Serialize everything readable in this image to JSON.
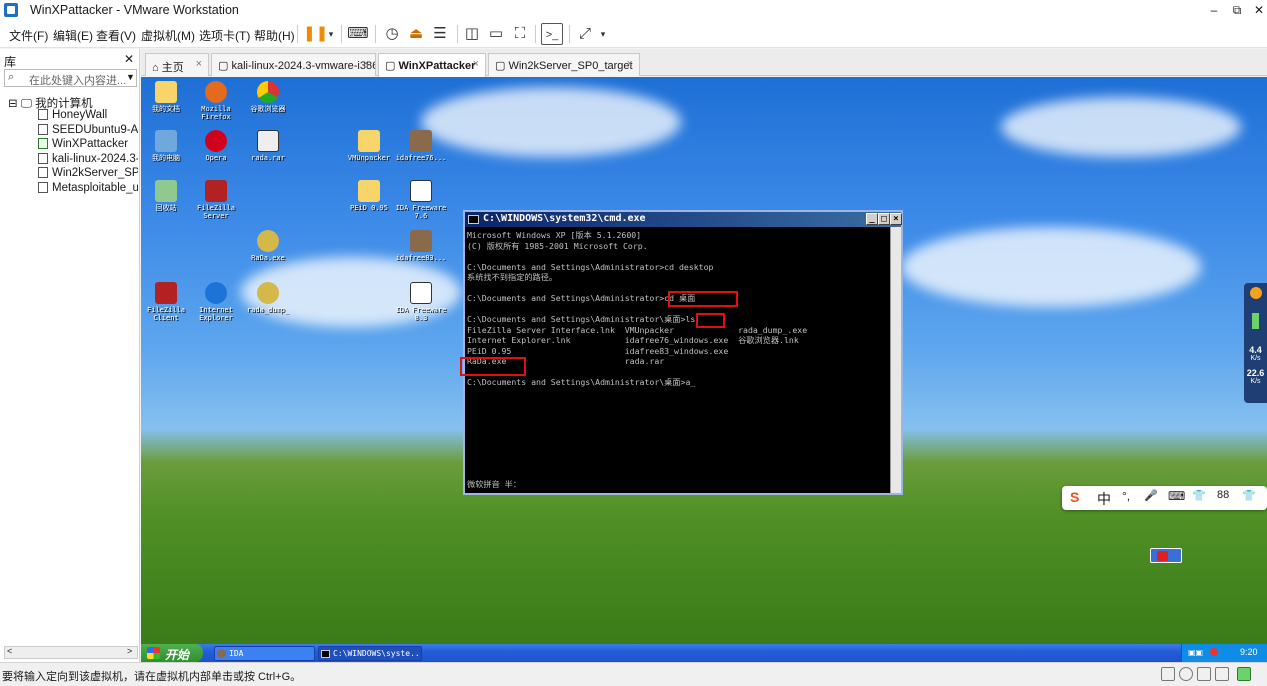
{
  "window": {
    "title": "WinXPattacker - VMware Workstation",
    "min": "–",
    "restore": "⧉",
    "close": "✕"
  },
  "menu": [
    "文件(F)",
    "编辑(E)",
    "查看(V)",
    "虚拟机(M)",
    "选项卡(T)",
    "帮助(H)"
  ],
  "toolbar_icons": [
    "pause-icon",
    "dropdown-icon",
    "send-ctrl-alt-del-icon",
    "snapshot-icon",
    "revert-snapshot-icon",
    "snapshot-manager-icon",
    "library-view-icon",
    "thumbnail-view-icon",
    "fullscreen-icon",
    "console-icon",
    "stretch-icon"
  ],
  "library": {
    "title": "库",
    "close": "✕",
    "search_placeholder": "在此处键入内容进...",
    "root": "我的计算机",
    "items": [
      "HoneyWall",
      "SEEDUbuntu9-Aug",
      "WinXPattacker",
      "kali-linux-2024.3-",
      "Win2kServer_SP0",
      "Metasploitable_u"
    ]
  },
  "tabs": [
    {
      "label": "主页"
    },
    {
      "label": "kali-linux-2024.3-vmware-i386"
    },
    {
      "label": "WinXPattacker"
    },
    {
      "label": "Win2kServer_SP0_target"
    }
  ],
  "desktop_icons": [
    {
      "label": "我的文档"
    },
    {
      "label": "Mozilla Firefox"
    },
    {
      "label": "谷歌浏览器"
    },
    {
      "label": "我的电脑"
    },
    {
      "label": "Opera"
    },
    {
      "label": "rada.rar"
    },
    {
      "label": "VMUnpacker"
    },
    {
      "label": "idafree76..."
    },
    {
      "label": "回收站"
    },
    {
      "label": "FileZilla Server"
    },
    {
      "label": "PEiD 0.95"
    },
    {
      "label": "IDA Freeware 7.6"
    },
    {
      "label": "RaDa.exe"
    },
    {
      "label": "idafree83..."
    },
    {
      "label": "FileZilla Client"
    },
    {
      "label": "Internet Explorer"
    },
    {
      "label": "rada_dump_"
    },
    {
      "label": "IDA Freeware 8.3"
    }
  ],
  "cmd": {
    "title": "C:\\WINDOWS\\system32\\cmd.exe",
    "lines": [
      "Microsoft Windows XP [版本 5.1.2600]",
      "(C) 版权所有 1985-2001 Microsoft Corp.",
      "",
      "C:\\Documents and Settings\\Administrator>cd desktop",
      "系统找不到指定的路径。",
      "",
      "C:\\Documents and Settings\\Administrator>cd 桌面",
      "",
      "C:\\Documents and Settings\\Administrator\\桌面>ls",
      "FileZilla Server Interface.lnk  VMUnpacker             rada_dump_.exe",
      "Internet Explorer.lnk           idafree76_windows.exe  谷歌浏览器.lnk",
      "PEiD 0.95                       idafree83_windows.exe",
      "RaDa.exe                        rada.rar",
      "",
      "C:\\Documents and Settings\\Administrator\\桌面>a_"
    ],
    "ime_status": "微软拼音 半："
  },
  "ime_bar": [
    "S",
    "中",
    "°,",
    "🎤",
    "⌨",
    "👕",
    "88",
    "👕"
  ],
  "side_widget": {
    "speed_up": "4.4",
    "unit_up": "K/s",
    "speed_down": "22.6",
    "unit_down": "K/s"
  },
  "taskbar": {
    "start": "开始",
    "tasks": [
      "IDA",
      "C:\\WINDOWS\\syste..."
    ],
    "clock": "9:20"
  },
  "statusbar": {
    "text": "要将输入定向到该虚拟机，请在虚拟机内部单击或按 Ctrl+G。"
  }
}
